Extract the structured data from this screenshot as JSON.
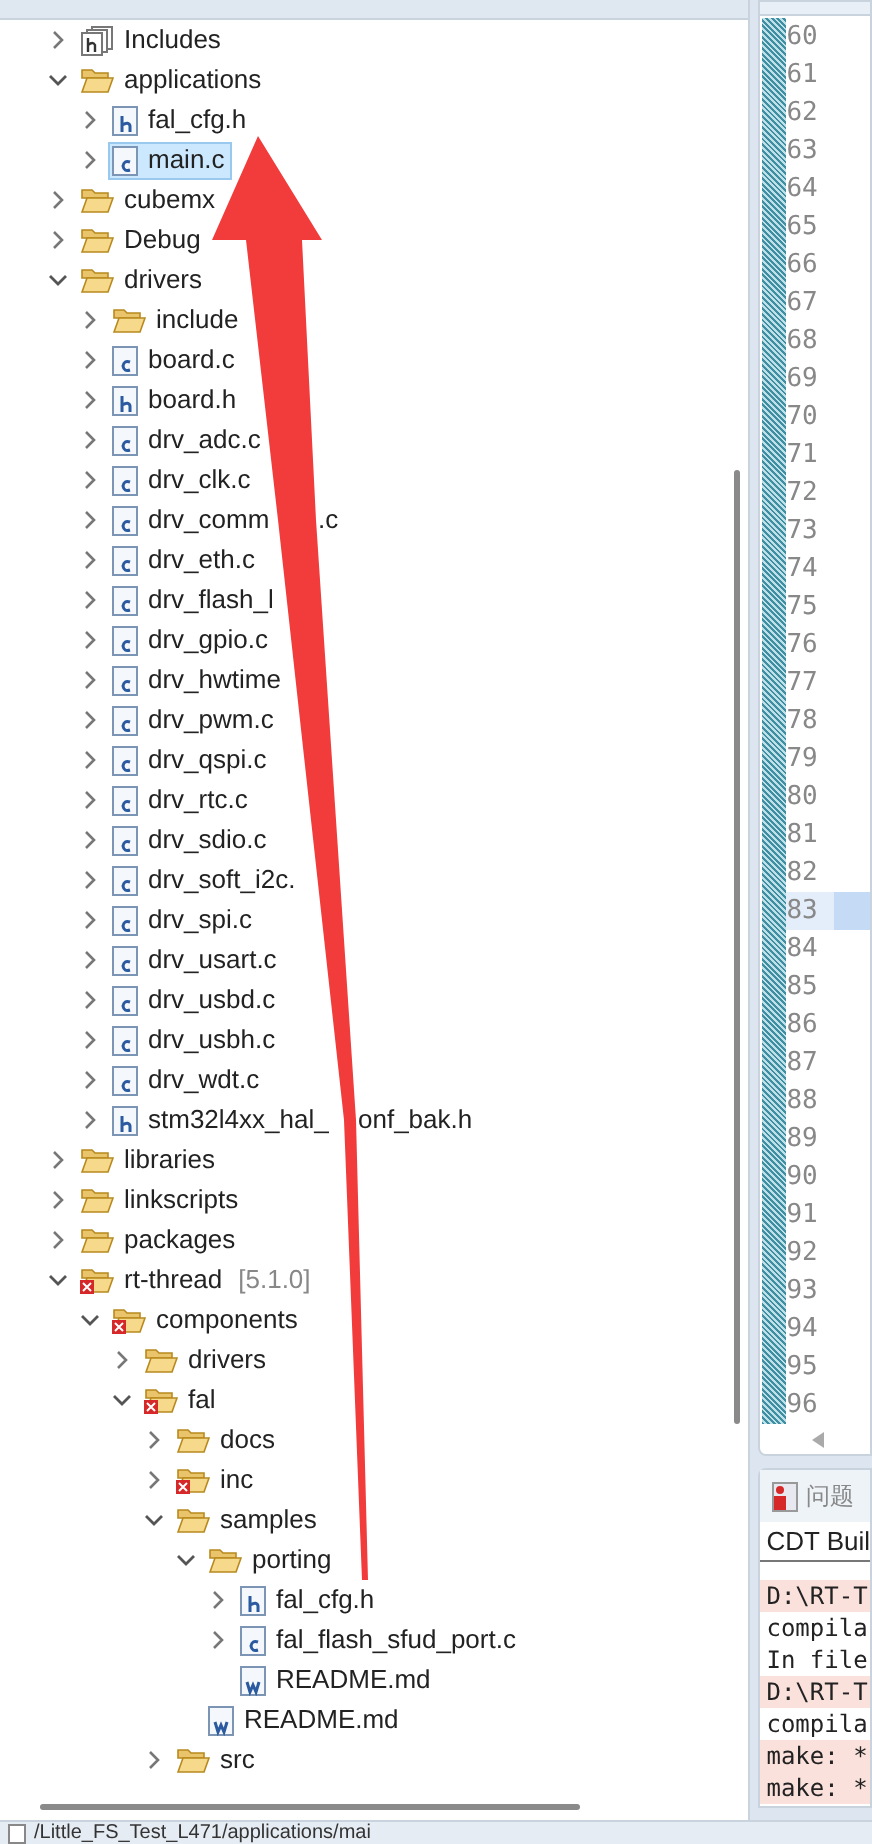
{
  "tree": [
    {
      "label": "Includes",
      "kind": "includes",
      "expanded": false
    },
    {
      "label": "applications",
      "kind": "folder",
      "expanded": true,
      "children": [
        {
          "label": "fal_cfg.h",
          "kind": "file-h",
          "expanded": false,
          "selected": false
        },
        {
          "label": "main.c",
          "kind": "file-c",
          "expanded": false,
          "selected": true
        }
      ]
    },
    {
      "label": "cubemx",
      "kind": "folder",
      "expanded": false
    },
    {
      "label": "Debug",
      "kind": "folder",
      "expanded": false
    },
    {
      "label": "drivers",
      "kind": "folder",
      "expanded": true,
      "children": [
        {
          "label": "include",
          "kind": "folder",
          "expanded": false
        },
        {
          "label": "board.c",
          "kind": "file-c",
          "expanded": false
        },
        {
          "label": "board.h",
          "kind": "file-h",
          "expanded": false
        },
        {
          "label": "drv_adc.c",
          "kind": "file-c",
          "expanded": false
        },
        {
          "label": "drv_clk.c",
          "kind": "file-c",
          "expanded": false
        },
        {
          "label": "drv_comm",
          "label_after": ".c",
          "kind": "file-c",
          "expanded": false
        },
        {
          "label": "drv_eth.c",
          "kind": "file-c",
          "expanded": false
        },
        {
          "label": "drv_flash_l",
          "kind": "file-c",
          "expanded": false
        },
        {
          "label": "drv_gpio.c",
          "kind": "file-c",
          "expanded": false
        },
        {
          "label": "drv_hwtime",
          "kind": "file-c",
          "expanded": false
        },
        {
          "label": "drv_pwm.c",
          "kind": "file-c",
          "expanded": false
        },
        {
          "label": "drv_qspi.c",
          "kind": "file-c",
          "expanded": false
        },
        {
          "label": "drv_rtc.c",
          "kind": "file-c",
          "expanded": false
        },
        {
          "label": "drv_sdio.c",
          "kind": "file-c",
          "expanded": false
        },
        {
          "label": "drv_soft_i2c.",
          "kind": "file-c",
          "expanded": false
        },
        {
          "label": "drv_spi.c",
          "kind": "file-c",
          "expanded": false
        },
        {
          "label": "drv_usart.c",
          "kind": "file-c",
          "expanded": false
        },
        {
          "label": "drv_usbd.c",
          "kind": "file-c",
          "expanded": false
        },
        {
          "label": "drv_usbh.c",
          "kind": "file-c",
          "expanded": false
        },
        {
          "label": "drv_wdt.c",
          "kind": "file-c",
          "expanded": false
        },
        {
          "label": "stm32l4xx_hal_",
          "label_after": "onf_bak.h",
          "kind": "file-h",
          "expanded": false
        }
      ]
    },
    {
      "label": "libraries",
      "kind": "folder",
      "expanded": false
    },
    {
      "label": "linkscripts",
      "kind": "folder",
      "expanded": false
    },
    {
      "label": "packages",
      "kind": "folder",
      "expanded": false
    },
    {
      "label": "rt-thread",
      "tag": "[5.1.0]",
      "kind": "folder-error",
      "expanded": true,
      "children": [
        {
          "label": "components",
          "kind": "folder-error",
          "expanded": true,
          "children": [
            {
              "label": "drivers",
              "kind": "folder",
              "expanded": false
            },
            {
              "label": "fal",
              "kind": "folder-error",
              "expanded": true,
              "children": [
                {
                  "label": "docs",
                  "kind": "folder",
                  "expanded": false
                },
                {
                  "label": "inc",
                  "kind": "folder-error",
                  "expanded": false
                },
                {
                  "label": "samples",
                  "kind": "folder",
                  "expanded": true,
                  "children": [
                    {
                      "label": "porting",
                      "kind": "folder",
                      "expanded": true,
                      "children": [
                        {
                          "label": "fal_cfg.h",
                          "kind": "file-h",
                          "expanded": false
                        },
                        {
                          "label": "fal_flash_sfud_port.c",
                          "kind": "file-c",
                          "expanded": false
                        },
                        {
                          "label": "README.md",
                          "kind": "file-md"
                        }
                      ]
                    },
                    {
                      "label": "README.md",
                      "kind": "file-md"
                    }
                  ]
                },
                {
                  "label": "src",
                  "kind": "folder",
                  "expanded": false
                }
              ]
            }
          ]
        }
      ]
    }
  ],
  "editor": {
    "lines": [
      {
        "number": "60",
        "selected": false
      },
      {
        "number": "61",
        "selected": false
      },
      {
        "number": "62",
        "selected": false
      },
      {
        "number": "63",
        "selected": false
      },
      {
        "number": "64",
        "selected": false
      },
      {
        "number": "65",
        "selected": false
      },
      {
        "number": "66",
        "selected": false
      },
      {
        "number": "67",
        "selected": false
      },
      {
        "number": "68",
        "selected": false
      },
      {
        "number": "69",
        "selected": false
      },
      {
        "number": "70",
        "selected": false
      },
      {
        "number": "71",
        "selected": false
      },
      {
        "number": "72",
        "selected": false
      },
      {
        "number": "73",
        "selected": false
      },
      {
        "number": "74",
        "selected": false
      },
      {
        "number": "75",
        "selected": false
      },
      {
        "number": "76",
        "selected": false
      },
      {
        "number": "77",
        "selected": false
      },
      {
        "number": "78",
        "selected": false
      },
      {
        "number": "79",
        "selected": false
      },
      {
        "number": "80",
        "selected": false
      },
      {
        "number": "81",
        "selected": false
      },
      {
        "number": "82",
        "selected": false
      },
      {
        "number": "83",
        "selected": true
      },
      {
        "number": "84",
        "selected": false
      },
      {
        "number": "85",
        "selected": false
      },
      {
        "number": "86",
        "selected": false
      },
      {
        "number": "87",
        "selected": false
      },
      {
        "number": "88",
        "selected": false
      },
      {
        "number": "89",
        "selected": false
      },
      {
        "number": "90",
        "selected": false
      },
      {
        "number": "91",
        "selected": false
      },
      {
        "number": "92",
        "selected": false
      },
      {
        "number": "93",
        "selected": false
      },
      {
        "number": "94",
        "selected": false
      },
      {
        "number": "95",
        "selected": false
      },
      {
        "number": "96",
        "selected": false
      }
    ]
  },
  "console": {
    "tab": "问题",
    "title": "CDT Buil",
    "lines": [
      {
        "text": "D:\\RT-T",
        "kind": "error"
      },
      {
        "text": "compila",
        "kind": "normal"
      },
      {
        "text": "In file",
        "kind": "normal"
      },
      {
        "text": "D:\\RT-T",
        "kind": "error"
      },
      {
        "text": "compila",
        "kind": "normal"
      },
      {
        "text": "make: *",
        "kind": "error"
      },
      {
        "text": "make: *",
        "kind": "error"
      }
    ]
  },
  "status_bar": {
    "path": "/Little_FS_Test_L471/applications/mai"
  }
}
